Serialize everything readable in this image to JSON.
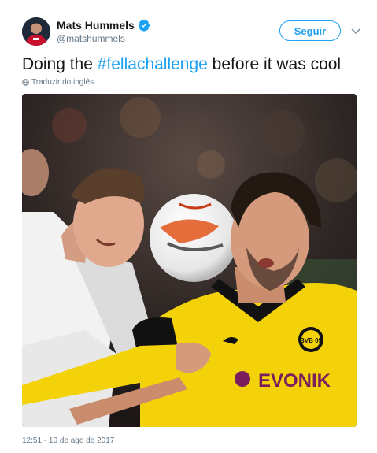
{
  "user": {
    "display_name": "Mats Hummels",
    "handle": "@matshummels",
    "verified": true,
    "avatar_icon": "avatar-photo"
  },
  "actions": {
    "follow_label": "Seguir",
    "menu_icon": "chevron-down-icon"
  },
  "tweet": {
    "text_before": "Doing the ",
    "hashtag": "#fellachallenge",
    "text_after": " before it was cool",
    "translate_label": "Traduzir do inglês",
    "timestamp": "12:51 - 10 de ago de 2017"
  },
  "photo": {
    "jersey_sponsor": "EVONIK",
    "crest": "BVB 09"
  },
  "colors": {
    "accent": "#1da1f2",
    "text": "#14171a",
    "muted": "#657786"
  }
}
